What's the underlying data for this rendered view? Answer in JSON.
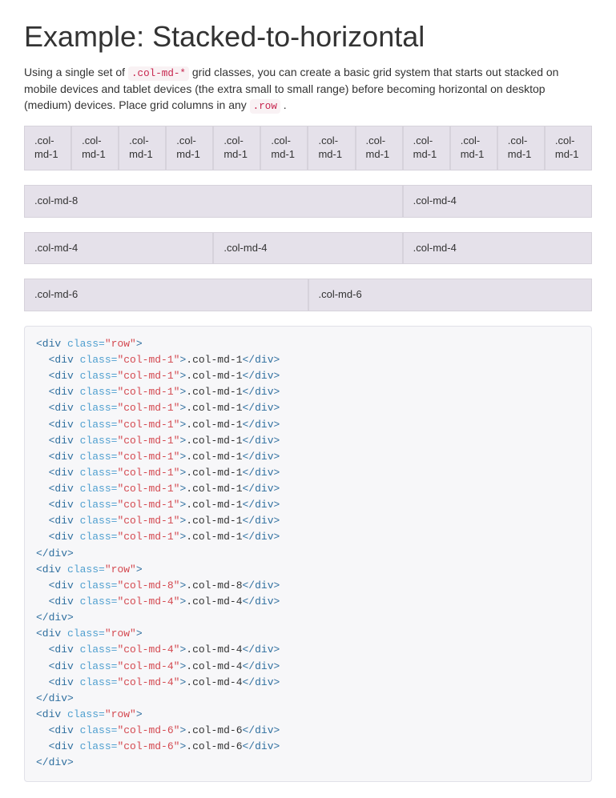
{
  "heading": "Example: Stacked-to-horizontal",
  "intro": {
    "part1": "Using a single set of ",
    "code1": ".col-md-*",
    "part2": " grid classes, you can create a basic grid system that starts out stacked on mobile devices and tablet devices (the extra small to small range) before becoming horizontal on desktop (medium) devices. Place grid columns in any ",
    "code2": ".row",
    "part3": "."
  },
  "rows": [
    {
      "cells": [
        {
          "w": "w1",
          "label": ".col-md-1"
        },
        {
          "w": "w1",
          "label": ".col-md-1"
        },
        {
          "w": "w1",
          "label": ".col-md-1"
        },
        {
          "w": "w1",
          "label": ".col-md-1"
        },
        {
          "w": "w1",
          "label": ".col-md-1"
        },
        {
          "w": "w1",
          "label": ".col-md-1"
        },
        {
          "w": "w1",
          "label": ".col-md-1"
        },
        {
          "w": "w1",
          "label": ".col-md-1"
        },
        {
          "w": "w1",
          "label": ".col-md-1"
        },
        {
          "w": "w1",
          "label": ".col-md-1"
        },
        {
          "w": "w1",
          "label": ".col-md-1"
        },
        {
          "w": "w1",
          "label": ".col-md-1"
        }
      ],
      "small": true
    },
    {
      "cells": [
        {
          "w": "w8",
          "label": ".col-md-8"
        },
        {
          "w": "w4",
          "label": ".col-md-4"
        }
      ]
    },
    {
      "cells": [
        {
          "w": "w4",
          "label": ".col-md-4"
        },
        {
          "w": "w4",
          "label": ".col-md-4"
        },
        {
          "w": "w4",
          "label": ".col-md-4"
        }
      ]
    },
    {
      "cells": [
        {
          "w": "w6",
          "label": ".col-md-6"
        },
        {
          "w": "w6",
          "label": ".col-md-6"
        }
      ]
    }
  ],
  "code_rows": [
    {
      "cols": [
        ".col-md-1",
        ".col-md-1",
        ".col-md-1",
        ".col-md-1",
        ".col-md-1",
        ".col-md-1",
        ".col-md-1",
        ".col-md-1",
        ".col-md-1",
        ".col-md-1",
        ".col-md-1",
        ".col-md-1"
      ]
    },
    {
      "cols": [
        ".col-md-8",
        ".col-md-4"
      ]
    },
    {
      "cols": [
        ".col-md-4",
        ".col-md-4",
        ".col-md-4"
      ]
    },
    {
      "cols": [
        ".col-md-6",
        ".col-md-6"
      ]
    }
  ]
}
